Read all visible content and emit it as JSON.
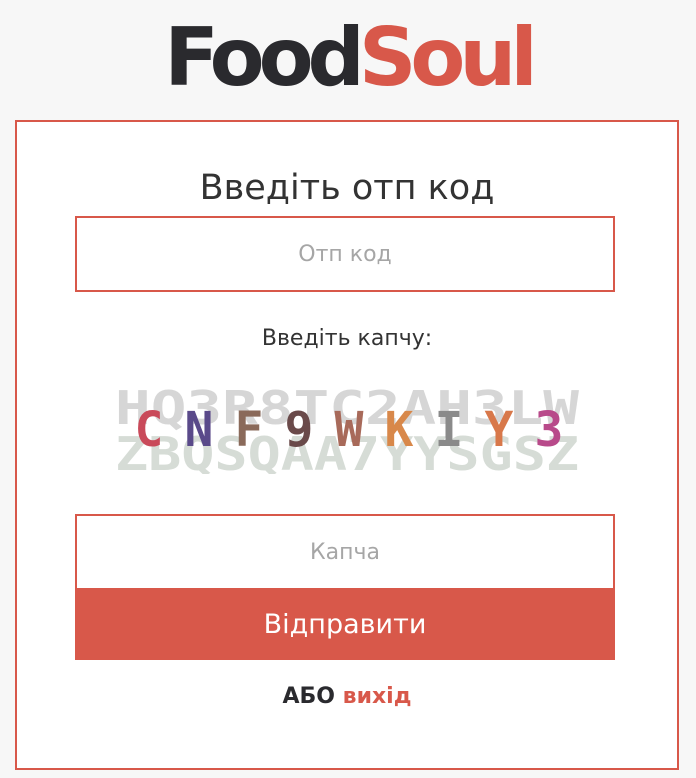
{
  "logo": {
    "part1": "Food",
    "part2": "Soul"
  },
  "form": {
    "title": "Введіть отп код",
    "otp_placeholder": "Отп код",
    "captcha_label": "Введіть капчу:",
    "captcha_noise_top": "HQ3R8TC2AH3LW",
    "captcha_noise_bottom": "ZBQSQAA7YYSGSZ",
    "captcha_code": "CNF9WKIY3",
    "captcha_placeholder": "Капча",
    "submit_label": "Відправити",
    "or_label": "АБО",
    "exit_label": "вихід"
  },
  "colors": {
    "accent": "#d8584a",
    "dark_text": "#2a2a2e",
    "captcha_letters": [
      "#c94a5a",
      "#5a4a8a",
      "#8a6a5a",
      "#6a4a4a",
      "#a86a5a",
      "#d8884a",
      "#8a8a8a",
      "#d8784a",
      "#b84a8a"
    ]
  }
}
